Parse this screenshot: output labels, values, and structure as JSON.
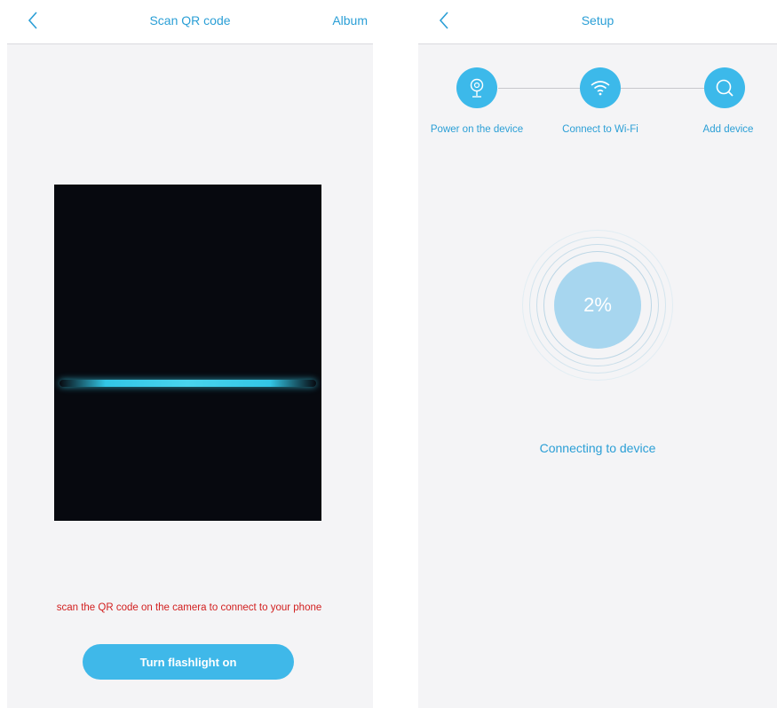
{
  "scan_screen": {
    "title": "Scan QR code",
    "album_label": "Album",
    "instruction": "scan the QR code on the camera to connect to your phone",
    "flashlight_button": "Turn flashlight on"
  },
  "setup_screen": {
    "title": "Setup",
    "steps": [
      {
        "label": "Power on the device",
        "icon": "power-plug-icon"
      },
      {
        "label": "Connect to Wi-Fi",
        "icon": "wifi-icon"
      },
      {
        "label": "Add device",
        "icon": "search-icon"
      }
    ],
    "progress": "2%",
    "status": "Connecting to device"
  },
  "colors": {
    "accent": "#3cb9ea",
    "text_blue": "#2b9fd6",
    "warning_red": "#d21f1f",
    "progress_fill": "#a7d6ef"
  }
}
